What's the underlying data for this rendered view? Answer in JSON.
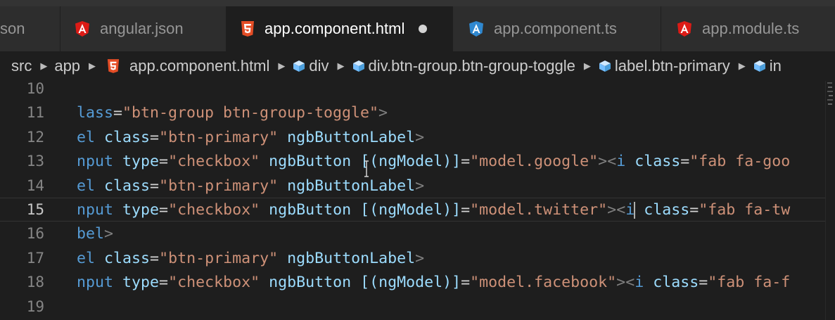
{
  "tabs": [
    {
      "label": "son",
      "icon": "none",
      "active": false
    },
    {
      "label": "angular.json",
      "icon": "angular-icon",
      "active": false
    },
    {
      "label": "app.component.html",
      "icon": "html5-icon",
      "active": true,
      "dirty": true
    },
    {
      "label": "app.component.ts",
      "icon": "angular-ts-icon",
      "active": false
    },
    {
      "label": "app.module.ts",
      "icon": "angular-icon",
      "active": false
    }
  ],
  "breadcrumbs": [
    "src",
    "app",
    "app.component.html",
    "div",
    "div.btn-group.btn-group-toggle",
    "label.btn-primary",
    "in"
  ],
  "editor": {
    "current_line": 15,
    "lines": [
      {
        "n": "10",
        "text": ""
      },
      {
        "n": "11",
        "text": "lass=\"btn-group btn-group-toggle\">"
      },
      {
        "n": "12",
        "text": "el class=\"btn-primary\" ngbButtonLabel>"
      },
      {
        "n": "13",
        "text": "nput type=\"checkbox\" ngbButton [(ngModel)]=\"model.google\"><i class=\"fab fa-goo"
      },
      {
        "n": "14",
        "text": "el class=\"btn-primary\" ngbButtonLabel>"
      },
      {
        "n": "15",
        "text": "nput type=\"checkbox\" ngbButton [(ngModel)]=\"model.twitter\"><i class=\"fab fa-tw"
      },
      {
        "n": "16",
        "text": "bel>"
      },
      {
        "n": "17",
        "text": "el class=\"btn-primary\" ngbButtonLabel>"
      },
      {
        "n": "18",
        "text": "nput type=\"checkbox\" ngbButton [(ngModel)]=\"model.facebook\"><i class=\"fab fa-f"
      },
      {
        "n": "19",
        "text": ""
      }
    ]
  },
  "colors": {
    "background": "#1e1e1e",
    "tag": "#569cd6",
    "attribute": "#9cdcfe",
    "string": "#ce9178",
    "punctuation": "#808080",
    "angular_red": "#dd1b16",
    "html_orange": "#e44d26",
    "ts_blue": "#2f88d0"
  }
}
